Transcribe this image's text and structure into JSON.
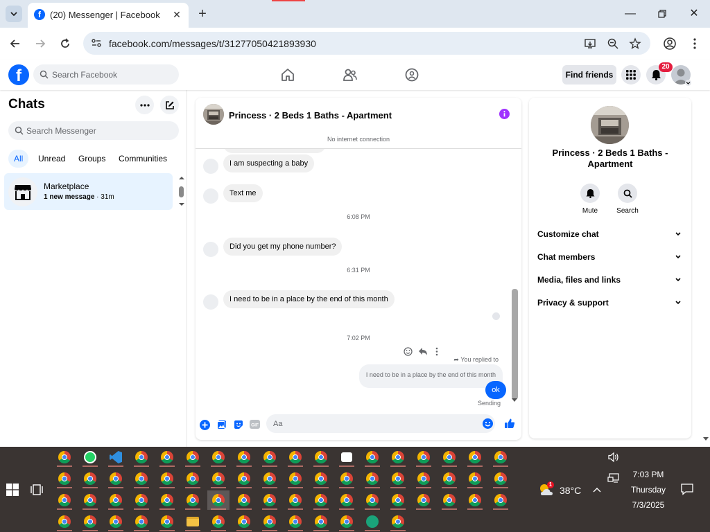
{
  "browser": {
    "tab_title": "(20) Messenger | Facebook",
    "url": "facebook.com/messages/t/31277050421893930"
  },
  "fb_header": {
    "search_placeholder": "Search Facebook",
    "find_friends": "Find friends",
    "notification_count": "20"
  },
  "chats": {
    "title": "Chats",
    "search_placeholder": "Search Messenger",
    "filters": [
      "All",
      "Unread",
      "Groups",
      "Communities"
    ],
    "active_filter": "All",
    "items": [
      {
        "name": "Marketplace",
        "preview": "1 new message",
        "time": "· 31m"
      }
    ]
  },
  "conversation": {
    "title": "Princess · 2 Beds 1 Baths - Apartment",
    "status": "No internet connection",
    "messages": [
      {
        "type": "in",
        "text": "I am suspecting a baby"
      },
      {
        "type": "in",
        "text": "Text me"
      },
      {
        "type": "time",
        "text": "6:08 PM"
      },
      {
        "type": "in",
        "text": "Did you get my phone number?"
      },
      {
        "type": "time",
        "text": "6:31 PM"
      },
      {
        "type": "in",
        "text": "I need to be in a place by the end of this month"
      },
      {
        "type": "time",
        "text": "7:02 PM"
      }
    ],
    "reply_label": "You replied to",
    "replied_text": "I need to be in a place by the end of this month",
    "sent_text": "ok",
    "sent_status": "Sending",
    "composer_placeholder": "Aa"
  },
  "info_panel": {
    "title": "Princess · 2 Beds 1 Baths - Apartment",
    "actions": [
      "Mute",
      "Search"
    ],
    "sections": [
      "Customize chat",
      "Chat members",
      "Media, files and links",
      "Privacy & support"
    ]
  },
  "taskbar": {
    "weather_temp": "38°C",
    "weather_badge": "1",
    "time": "7:03 PM",
    "day": "Thursday",
    "date": "7/3/2025"
  },
  "colors": {
    "facebook_blue": "#0866ff",
    "active_chat_bg": "#e7f3ff",
    "badge_red": "#e41e3f",
    "info_purple": "#a033ff",
    "taskbar_bg": "#3a3432"
  }
}
